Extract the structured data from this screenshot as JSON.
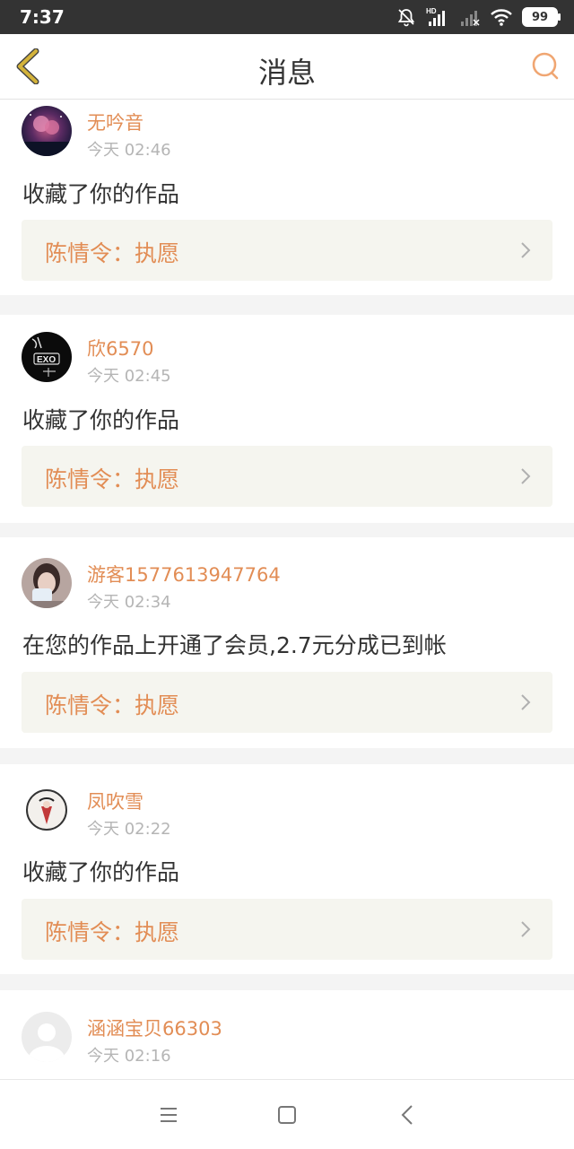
{
  "status_bar": {
    "time": "7:37",
    "network_label": "HD",
    "battery": "99"
  },
  "header": {
    "title": "消息",
    "back_icon": "chevron-left-icon",
    "search_icon": "search-icon"
  },
  "colors": {
    "accent": "#e28d55",
    "back_icon": "#d4b33a",
    "work_bg": "#f5f5ef"
  },
  "messages": [
    {
      "user": "无吟音",
      "time": "今天 02:46",
      "text": "收藏了你的作品",
      "work": "陈情令：执愿",
      "avatar": "night-blossom-avatar"
    },
    {
      "user": "欣6570",
      "time": "今天 02:45",
      "text": "收藏了你的作品",
      "work": "陈情令：执愿",
      "avatar": "exo-avatar"
    },
    {
      "user": "游客1577613947764",
      "time": "今天 02:34",
      "text": "在您的作品上开通了会员,2.7元分成已到帐",
      "work": "陈情令：执愿",
      "avatar": "person-photo-avatar"
    },
    {
      "user": "凤吹雪",
      "time": "今天 02:22",
      "text": "收藏了你的作品",
      "work": "陈情令：执愿",
      "avatar": "illustration-avatar"
    },
    {
      "user": "涵涵宝贝66303",
      "time": "今天 02:16",
      "avatar": "default-avatar"
    }
  ],
  "nav_bar": {
    "menu_icon": "menu-icon",
    "home_icon": "home-square-icon",
    "back_icon": "back-triangle-icon"
  }
}
